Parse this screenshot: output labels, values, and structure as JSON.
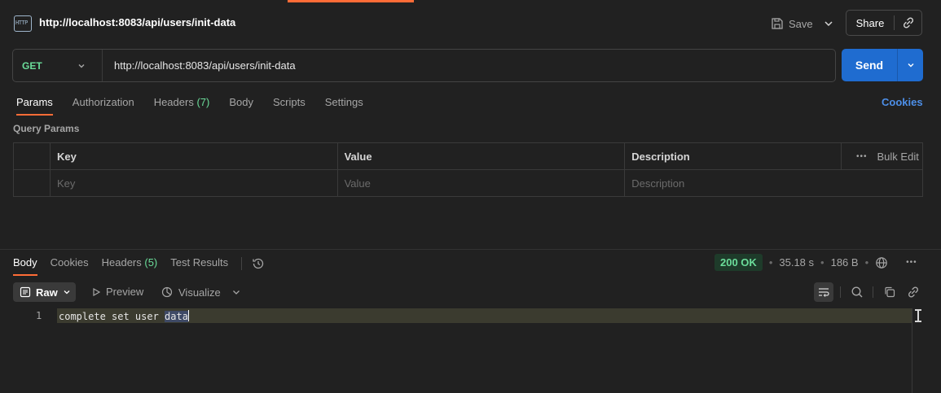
{
  "request": {
    "title": "http://localhost:8083/api/users/init-data",
    "icon_text": "HTTP",
    "method": "GET",
    "url": "http://localhost:8083/api/users/init-data"
  },
  "header": {
    "save_label": "Save",
    "share_label": "Share"
  },
  "send": {
    "label": "Send"
  },
  "request_tabs": [
    {
      "label": "Params",
      "count": ""
    },
    {
      "label": "Authorization",
      "count": ""
    },
    {
      "label": "Headers",
      "count": "(7)"
    },
    {
      "label": "Body",
      "count": ""
    },
    {
      "label": "Scripts",
      "count": ""
    },
    {
      "label": "Settings",
      "count": ""
    }
  ],
  "cookies_label": "Cookies",
  "query_params": {
    "title": "Query Params",
    "columns": {
      "key": "Key",
      "value": "Value",
      "description": "Description"
    },
    "bulk_edit": "Bulk Edit",
    "placeholders": {
      "key": "Key",
      "value": "Value",
      "description": "Description"
    }
  },
  "response_tabs": [
    {
      "label": "Body",
      "count": ""
    },
    {
      "label": "Cookies",
      "count": ""
    },
    {
      "label": "Headers",
      "count": "(5)"
    },
    {
      "label": "Test Results",
      "count": ""
    }
  ],
  "status": {
    "code": "200 OK",
    "time": "35.18 s",
    "size": "186 B"
  },
  "response_toolbar": {
    "raw": "Raw",
    "preview": "Preview",
    "visualize": "Visualize"
  },
  "response_body": {
    "line_number": "1",
    "text_before": "complete set user ",
    "text_selected": "data"
  },
  "colors": {
    "accent": "#ff6c37",
    "send": "#1f6cd0",
    "method": "#6bdd9a",
    "link": "#4d8fe8"
  }
}
